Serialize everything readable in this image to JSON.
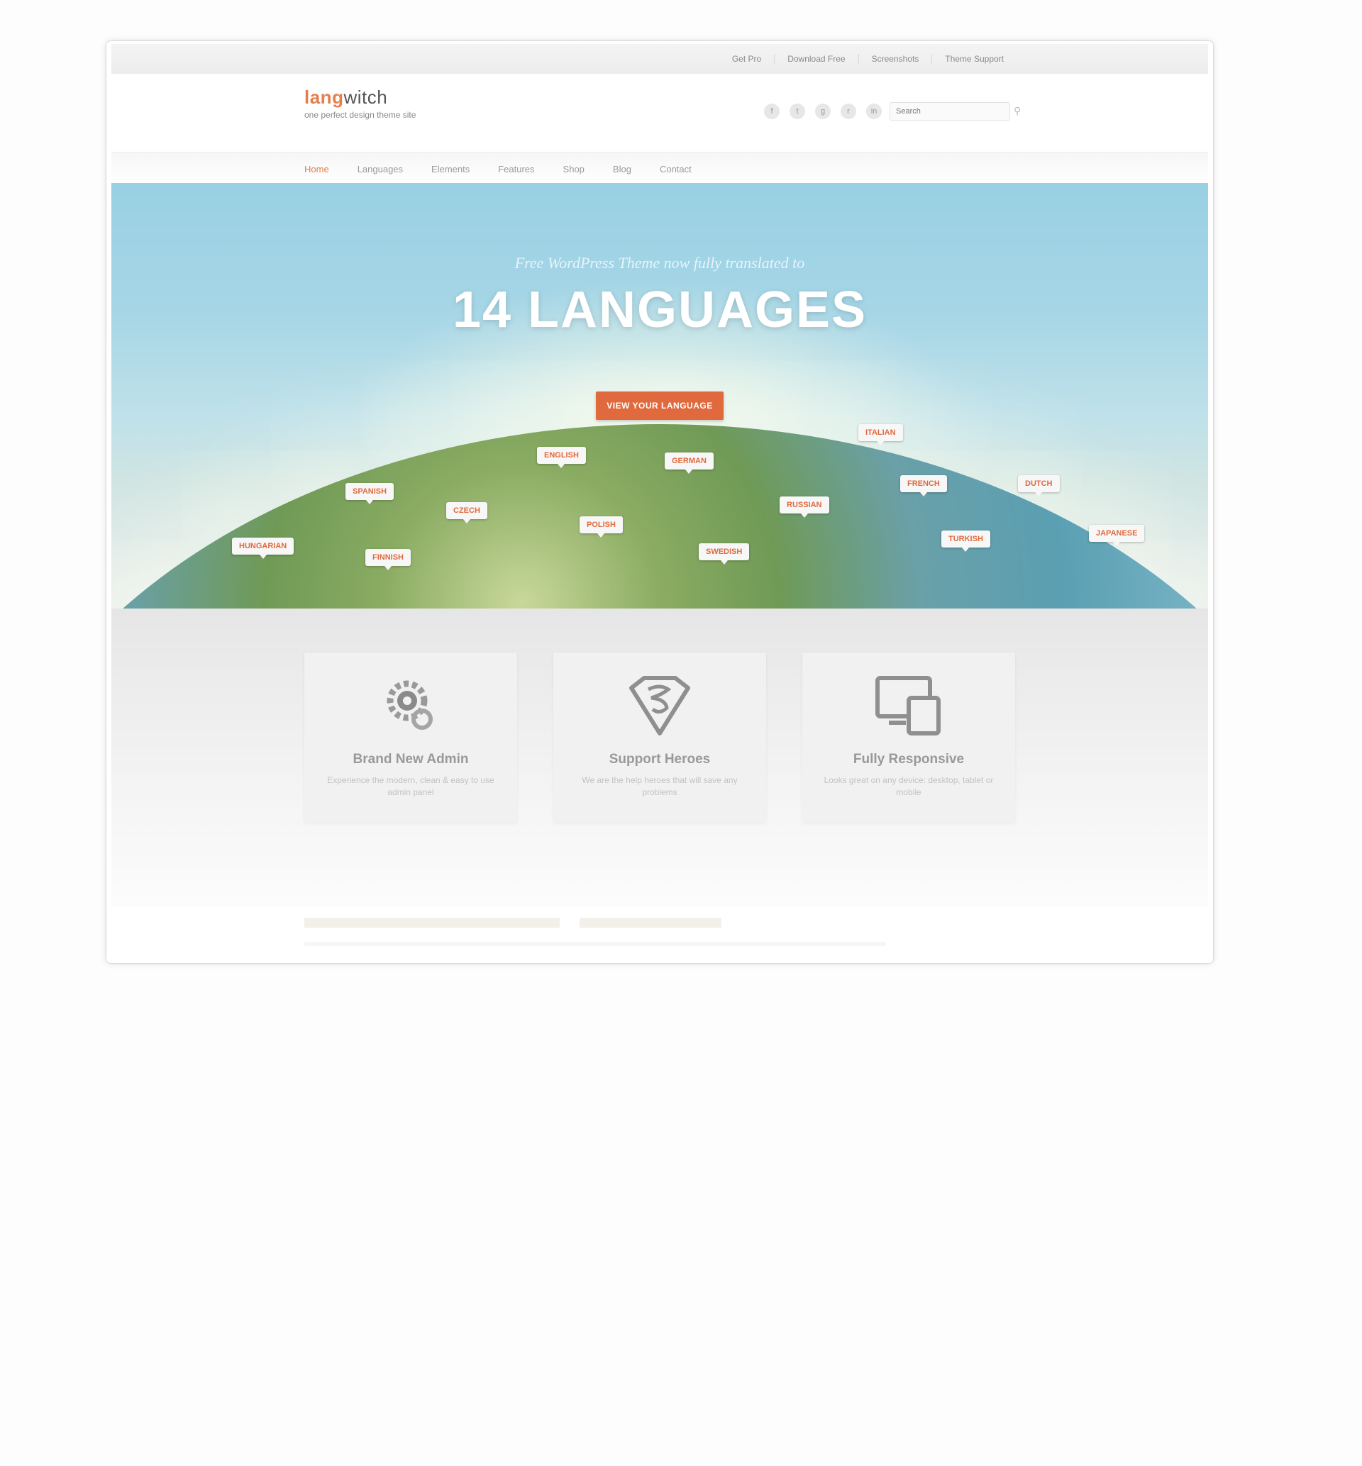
{
  "topbar": {
    "links": [
      "Get Pro",
      "Download Free",
      "Screenshots",
      "Theme Support"
    ]
  },
  "header": {
    "logo_accent": "lang",
    "logo_rest": "witch",
    "logo_tagline": "one perfect design theme site",
    "social_icons": [
      "facebook-icon",
      "twitter-icon",
      "googleplus-icon",
      "rss-icon",
      "linkedin-icon"
    ],
    "social_glyphs": [
      "f",
      "t",
      "g",
      "r",
      "in"
    ],
    "search_placeholder": "Search"
  },
  "nav": {
    "items": [
      "Home",
      "Languages",
      "Elements",
      "Features",
      "Shop",
      "Blog",
      "Contact"
    ],
    "active": "Home"
  },
  "hero": {
    "subtitle": "Free WordPress Theme now fully translated to",
    "title": "14 LANGUAGES",
    "button_label": "VIEW YOUR LANGUAGE",
    "pins": [
      "ITALIAN",
      "ENGLISH",
      "GERMAN",
      "SPANISH",
      "FRENCH",
      "DUTCH",
      "CZECH",
      "RUSSIAN",
      "POLISH",
      "HUNGARIAN",
      "FINNISH",
      "SWEDISH",
      "TURKISH",
      "JAPANESE"
    ]
  },
  "features": [
    {
      "icon": "gear-icon",
      "title": "Brand New Admin",
      "text": "Experience the modern, clean & easy to use admin panel"
    },
    {
      "icon": "superman-icon",
      "title": "Support Heroes",
      "text": "We are the help heroes that will save any problems"
    },
    {
      "icon": "devices-icon",
      "title": "Fully Responsive",
      "text": "Looks great on any device: desktop, tablet or mobile"
    }
  ],
  "colors": {
    "accent": "#e06a3d",
    "sky": "#99d0e3"
  }
}
